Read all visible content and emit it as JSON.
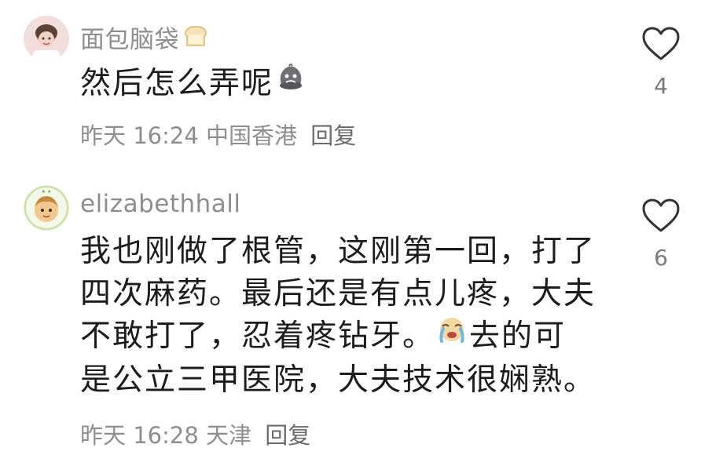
{
  "comments": [
    {
      "username": "面包脑袋",
      "username_emoji": "bread-icon",
      "content_lines": [
        "然后怎么弄呢"
      ],
      "content_emoji": "sad-face-icon",
      "time": "昨天 16:24",
      "location": "中国香港",
      "reply_label": "回复",
      "like_count": "4"
    },
    {
      "username": "elizabethhall",
      "content_lines": [
        "我也刚做了根管，这刚第一回，打了",
        "四次麻药。最后还是有点儿疼，大夫",
        "不敢打了，忍着疼钻牙。",
        "是公立三甲医院，大夫技术很娴熟。"
      ],
      "content_line3_after_emoji": "去的可",
      "content_emoji": "crying-face-icon",
      "time": "昨天 16:28",
      "location": "天津",
      "reply_label": "回复",
      "like_count": "6"
    }
  ],
  "colors": {
    "username": "#8e8e8e",
    "content": "#1c1c1c",
    "meta": "#8e8e8e",
    "heart_outline": "#333333"
  }
}
